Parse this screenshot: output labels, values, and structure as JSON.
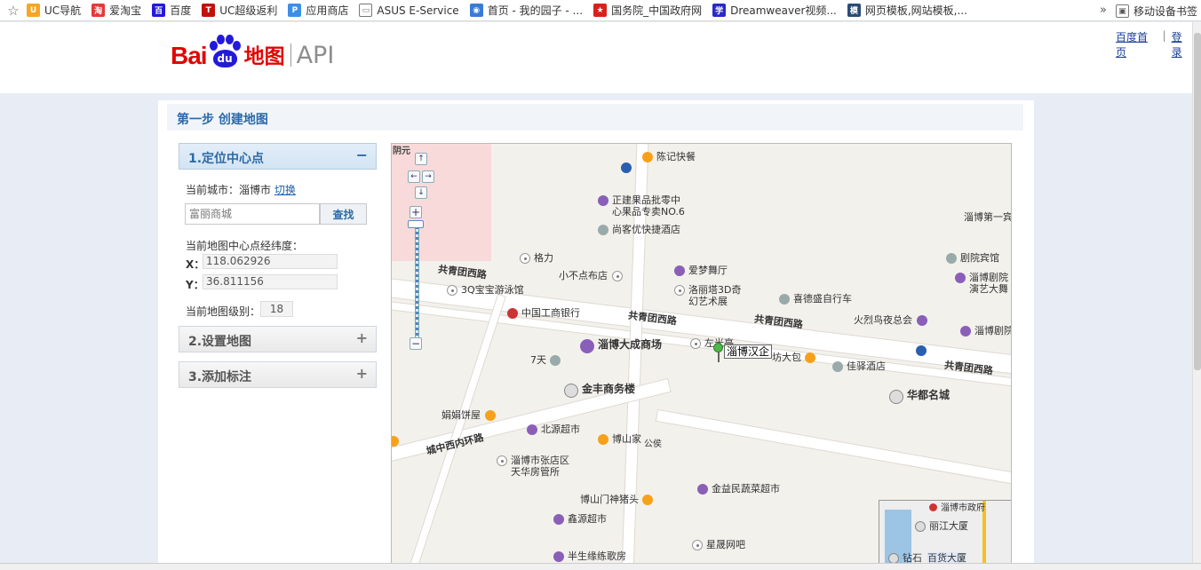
{
  "bookmarks": {
    "items": [
      {
        "label": "UC导航",
        "color": "#f5a623",
        "glyph": "U"
      },
      {
        "label": "爱淘宝",
        "color": "#e4393c",
        "glyph": "淘"
      },
      {
        "label": "百度",
        "color": "#2319dc",
        "glyph": "百"
      },
      {
        "label": "UC超级返利",
        "color": "#c0120c",
        "glyph": "T"
      },
      {
        "label": "应用商店",
        "color": "#3d8ee8",
        "glyph": "P"
      },
      {
        "label": "ASUS E-Service",
        "color": "#777777",
        "glyph": "▭"
      },
      {
        "label": "首页 - 我的园子 - ...",
        "color": "#3a7bd5",
        "glyph": "◉"
      },
      {
        "label": "国务院_中国政府网",
        "color": "#d8201c",
        "glyph": "★"
      },
      {
        "label": "Dreamweaver视频...",
        "color": "#2a2ac8",
        "glyph": "学"
      },
      {
        "label": "网页模板,网站模板,...",
        "color": "#2b4d73",
        "glyph": "模"
      }
    ],
    "more": "»",
    "mobile_label": "移动设备书签"
  },
  "header": {
    "logo_bai": "Bai",
    "logo_du": "du",
    "logo_ditu": "地图",
    "logo_api": "API",
    "links": [
      "百度首页",
      "登录"
    ],
    "link_sep": "|"
  },
  "step": {
    "title": "第一步 创建地图"
  },
  "panels": [
    {
      "title": "1.定位中心点",
      "toggle": "−",
      "expanded": true
    },
    {
      "title": "2.设置地图",
      "toggle": "+",
      "expanded": false
    },
    {
      "title": "3.添加标注",
      "toggle": "+",
      "expanded": false
    }
  ],
  "locate": {
    "city_label": "当前城市：淄博市",
    "switch_link": "切换",
    "search_placeholder": "富丽商城",
    "search_button": "查找",
    "center_label": "当前地图中心点经纬度：",
    "x_label": "X：",
    "x_value": "118.062926",
    "y_label": "Y：",
    "y_value": "36.811156",
    "zoom_label": "当前地图级别：",
    "zoom_value": "18"
  },
  "map": {
    "nav": {
      "up": "↑",
      "left": "←",
      "right": "→",
      "down": "↓",
      "zoom_in": "+",
      "zoom_out": "−"
    },
    "corner_label": "阴元",
    "roads": {
      "gongqing_1": "共青团西路",
      "gongqing_2": "共青团西路",
      "gongqing_3": "共青团西路",
      "gongqing_4": "共青团西路",
      "chengzhong": "城中西内环路"
    },
    "pois": {
      "chenji": "陈记快餐",
      "zhengjian": "正建果品批零中",
      "zhengjian2": "心果品专卖NO.6",
      "shangke": "尚客优快捷酒店",
      "geli": "格力",
      "aimeng": "爱梦舞厅",
      "xiaobu": "小不点布店",
      "youyong": "3Q宝宝游泳馆",
      "luolita": "洛丽塔3D奇",
      "luolita2": "幻艺术展",
      "xide": "喜德盛自行车",
      "zibo_no1": "淄博第一宾",
      "juyuan": "剧院宾馆",
      "zibojuyuan": "淄博剧院",
      "zibojuyuan2": "演艺大舞",
      "gonghang": "中国工商银行",
      "huolie": "火烈鸟夜总会",
      "zibojuyuan3": "淄博剧院",
      "dacheng": "淄博大成商场",
      "zuoguang": "左光亭",
      "fangdabao": "坊大包",
      "jiayi": "佳驿酒店",
      "qitian": "7天",
      "jinfeng": "金丰商务楼",
      "huadu": "华都名城",
      "juanjuan": "娟娟饼屋",
      "beiyuan": "北源超市",
      "boshanjia": "博山家",
      "gongce": "公侯",
      "fangguan": "淄博市张店区",
      "fangguan2": "天华房管所",
      "boshanmen": "博山门神猪头",
      "jinyi": "金益民蔬菜超市",
      "xinyuan": "鑫源超市",
      "xingsheng": "星晟网吧",
      "bansheng": "半生缘练歌房"
    },
    "marker_label": "淄博汉企",
    "overview": {
      "gov": "淄博市政府",
      "lijiang": "丽江大厦",
      "zuanshi": "钻石",
      "baihuo": "百货大厦"
    }
  }
}
